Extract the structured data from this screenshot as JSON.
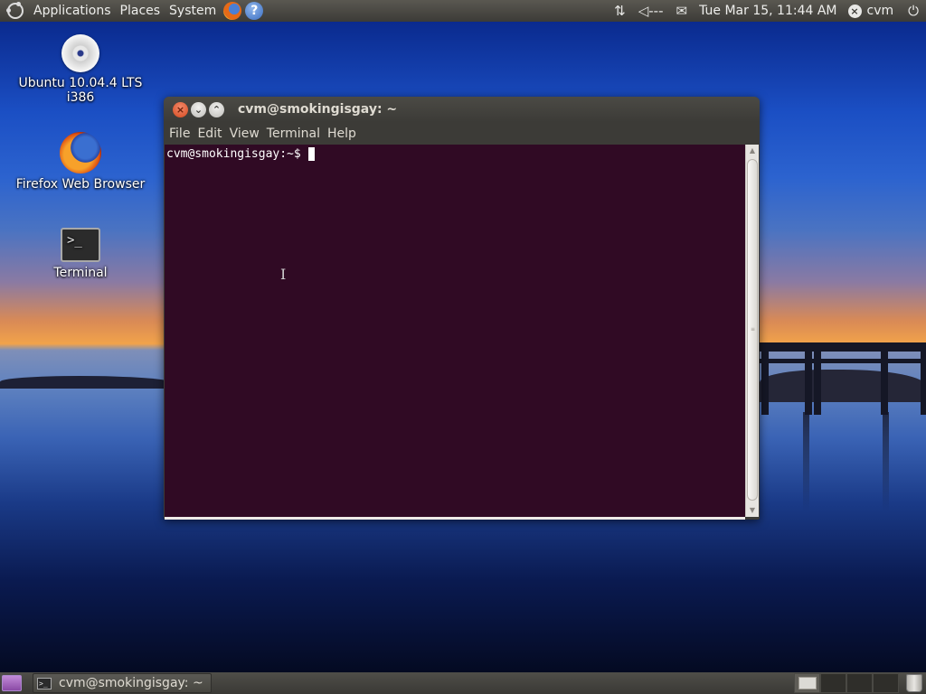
{
  "top_panel": {
    "menus": [
      "Applications",
      "Places",
      "System"
    ],
    "launchers": [
      {
        "icon": "firefox-icon"
      },
      {
        "icon": "help-icon",
        "glyph": "?"
      }
    ],
    "indicators": {
      "network_glyph": "⇅",
      "volume_glyph": "◁---",
      "mail_glyph": "✉"
    },
    "clock": "Tue Mar 15, 11:44 AM",
    "user": "cvm",
    "user_glyph": "×",
    "power_glyph": "⏻"
  },
  "desktop_icons": [
    {
      "label_line1": "Ubuntu 10.04.4 LTS",
      "label_line2": "i386",
      "icon": "cd-disc-icon"
    },
    {
      "label_line1": "Firefox Web Browser",
      "icon": "firefox-icon"
    },
    {
      "label_line1": "Terminal",
      "icon": "terminal-icon",
      "glyph": ">_"
    }
  ],
  "window": {
    "title": "cvm@smokingisgay: ~",
    "buttons": {
      "close": "×",
      "minimize": "⌄",
      "maximize": "⌃"
    },
    "menus": [
      "File",
      "Edit",
      "View",
      "Terminal",
      "Help"
    ],
    "terminal": {
      "prompt": "cvm@smokingisgay:~$",
      "background": "#300a24",
      "foreground": "#ffffff"
    },
    "ibeam_glyph": "I",
    "scroll_up_glyph": "▲",
    "scroll_down_glyph": "▼",
    "scroll_grip_glyph": "≡"
  },
  "bottom_panel": {
    "task_label": "cvm@smokingisgay: ~",
    "task_glyph": ">_",
    "workspaces": 4,
    "active_workspace": 1
  },
  "colors": {
    "panel": "#3c3b37",
    "accent": "#dd4814"
  }
}
